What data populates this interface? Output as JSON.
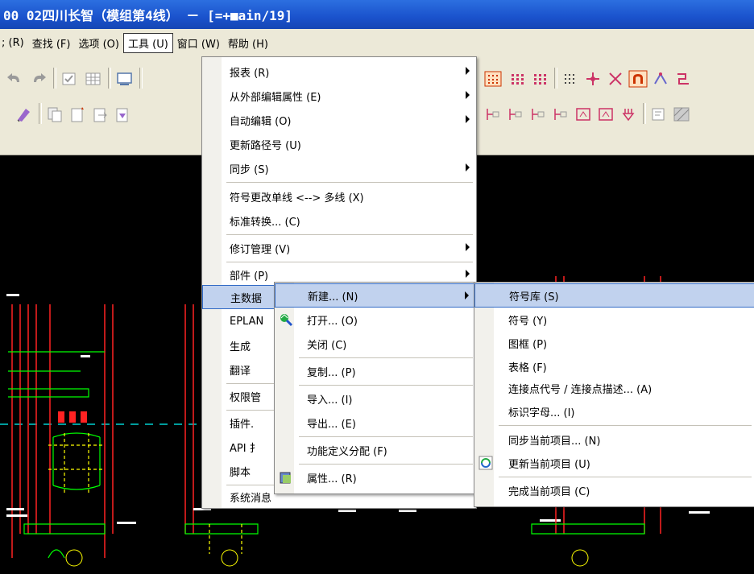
{
  "title": "00 02四川长智（模组第4线） － [=+■ain/19]",
  "menubar": {
    "items": [
      {
        "label": "; (R)"
      },
      {
        "label": "查找 (F)"
      },
      {
        "label": "选项 (O)"
      },
      {
        "label": "工具 (U)"
      },
      {
        "label": "窗口 (W)"
      },
      {
        "label": "帮助 (H)"
      }
    ]
  },
  "tools_menu": {
    "items": [
      {
        "label": "报表 (R)",
        "submenu": true
      },
      {
        "label": "从外部编辑属性 (E)",
        "submenu": true
      },
      {
        "label": "自动编辑 (O)",
        "submenu": true
      },
      {
        "label": "更新路径号 (U)",
        "submenu": false
      },
      {
        "label": "同步 (S)",
        "submenu": true
      },
      {
        "label": "符号更改单线 <--> 多线 (X)",
        "submenu": false
      },
      {
        "label": "标准转换... (C)",
        "submenu": false
      },
      {
        "label": "修订管理 (V)",
        "submenu": true
      },
      {
        "label": "部件 (P)",
        "submenu": true
      },
      {
        "label": "主数据",
        "submenu": true
      },
      {
        "label": "EPLAN",
        "submenu": false
      },
      {
        "label": "生成",
        "submenu": false
      },
      {
        "label": "翻译",
        "submenu": false
      },
      {
        "label": "权限管",
        "submenu": false
      },
      {
        "label": "插件.",
        "submenu": false
      },
      {
        "label": "API 扌",
        "submenu": false
      },
      {
        "label": "脚本",
        "submenu": false
      },
      {
        "label": "系统消息",
        "submenu": false
      }
    ]
  },
  "masterdata_menu": {
    "items": [
      {
        "label": "新建... (N)"
      },
      {
        "label": "打开... (O)",
        "icon": "open-project-icon"
      },
      {
        "label": "关闭 (C)"
      },
      {
        "label": "复制... (P)"
      },
      {
        "label": "导入... (I)"
      },
      {
        "label": "导出... (E)"
      },
      {
        "label": "功能定义分配 (F)"
      },
      {
        "label": "属性... (R)",
        "icon": "properties-icon"
      }
    ]
  },
  "new_menu": {
    "items": [
      {
        "label": "符号库 (S)"
      },
      {
        "label": "符号 (Y)"
      },
      {
        "label": "图框 (P)"
      },
      {
        "label": "表格 (F)"
      },
      {
        "label": "连接点代号 / 连接点描述... (A)"
      },
      {
        "label": "标识字母... (I)"
      },
      {
        "label": "同步当前项目... (N)"
      },
      {
        "label": "更新当前项目 (U)",
        "icon": "update-project-icon"
      },
      {
        "label": "完成当前项目 (C)"
      }
    ]
  }
}
